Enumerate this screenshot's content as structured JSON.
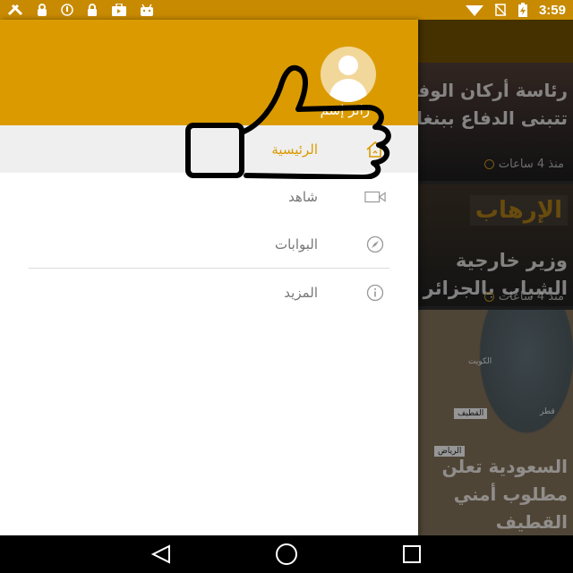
{
  "status_bar": {
    "time": "3:59",
    "icons": [
      "tools-icon",
      "lock-icon",
      "info-icon",
      "lock-icon",
      "briefcase-icon",
      "android-icon",
      "wifi-icon",
      "no-sim-icon",
      "battery-charging-icon"
    ],
    "color": "#c88a00"
  },
  "drawer": {
    "header_color": "#db9b00",
    "user_name": "زائر إسم",
    "menu": [
      {
        "label": "الرئيسية",
        "icon": "home-icon",
        "active": true
      },
      {
        "label": "شاهد",
        "icon": "video-icon",
        "active": false
      },
      {
        "label": "البوابات",
        "icon": "compass-icon",
        "active": false
      },
      {
        "label": "المزيد",
        "icon": "info-icon",
        "active": false
      }
    ]
  },
  "feed": {
    "cards": [
      {
        "headline": "رئاسة أركان الوفاق تتبنى الدفاع ببنغازي",
        "time": "منذ 4 ساعات"
      },
      {
        "tag": "الإرهاب",
        "headline": "وزير خارجية الشباب بالجزائر",
        "time": "منذ 4 ساعات"
      },
      {
        "headline": "السعودية تعلن مطلوب أمني القطيف",
        "map_labels": [
          "الكويت",
          "القطيف",
          "الرياض",
          "قطر"
        ]
      }
    ]
  },
  "accent_color": "#db9b00"
}
